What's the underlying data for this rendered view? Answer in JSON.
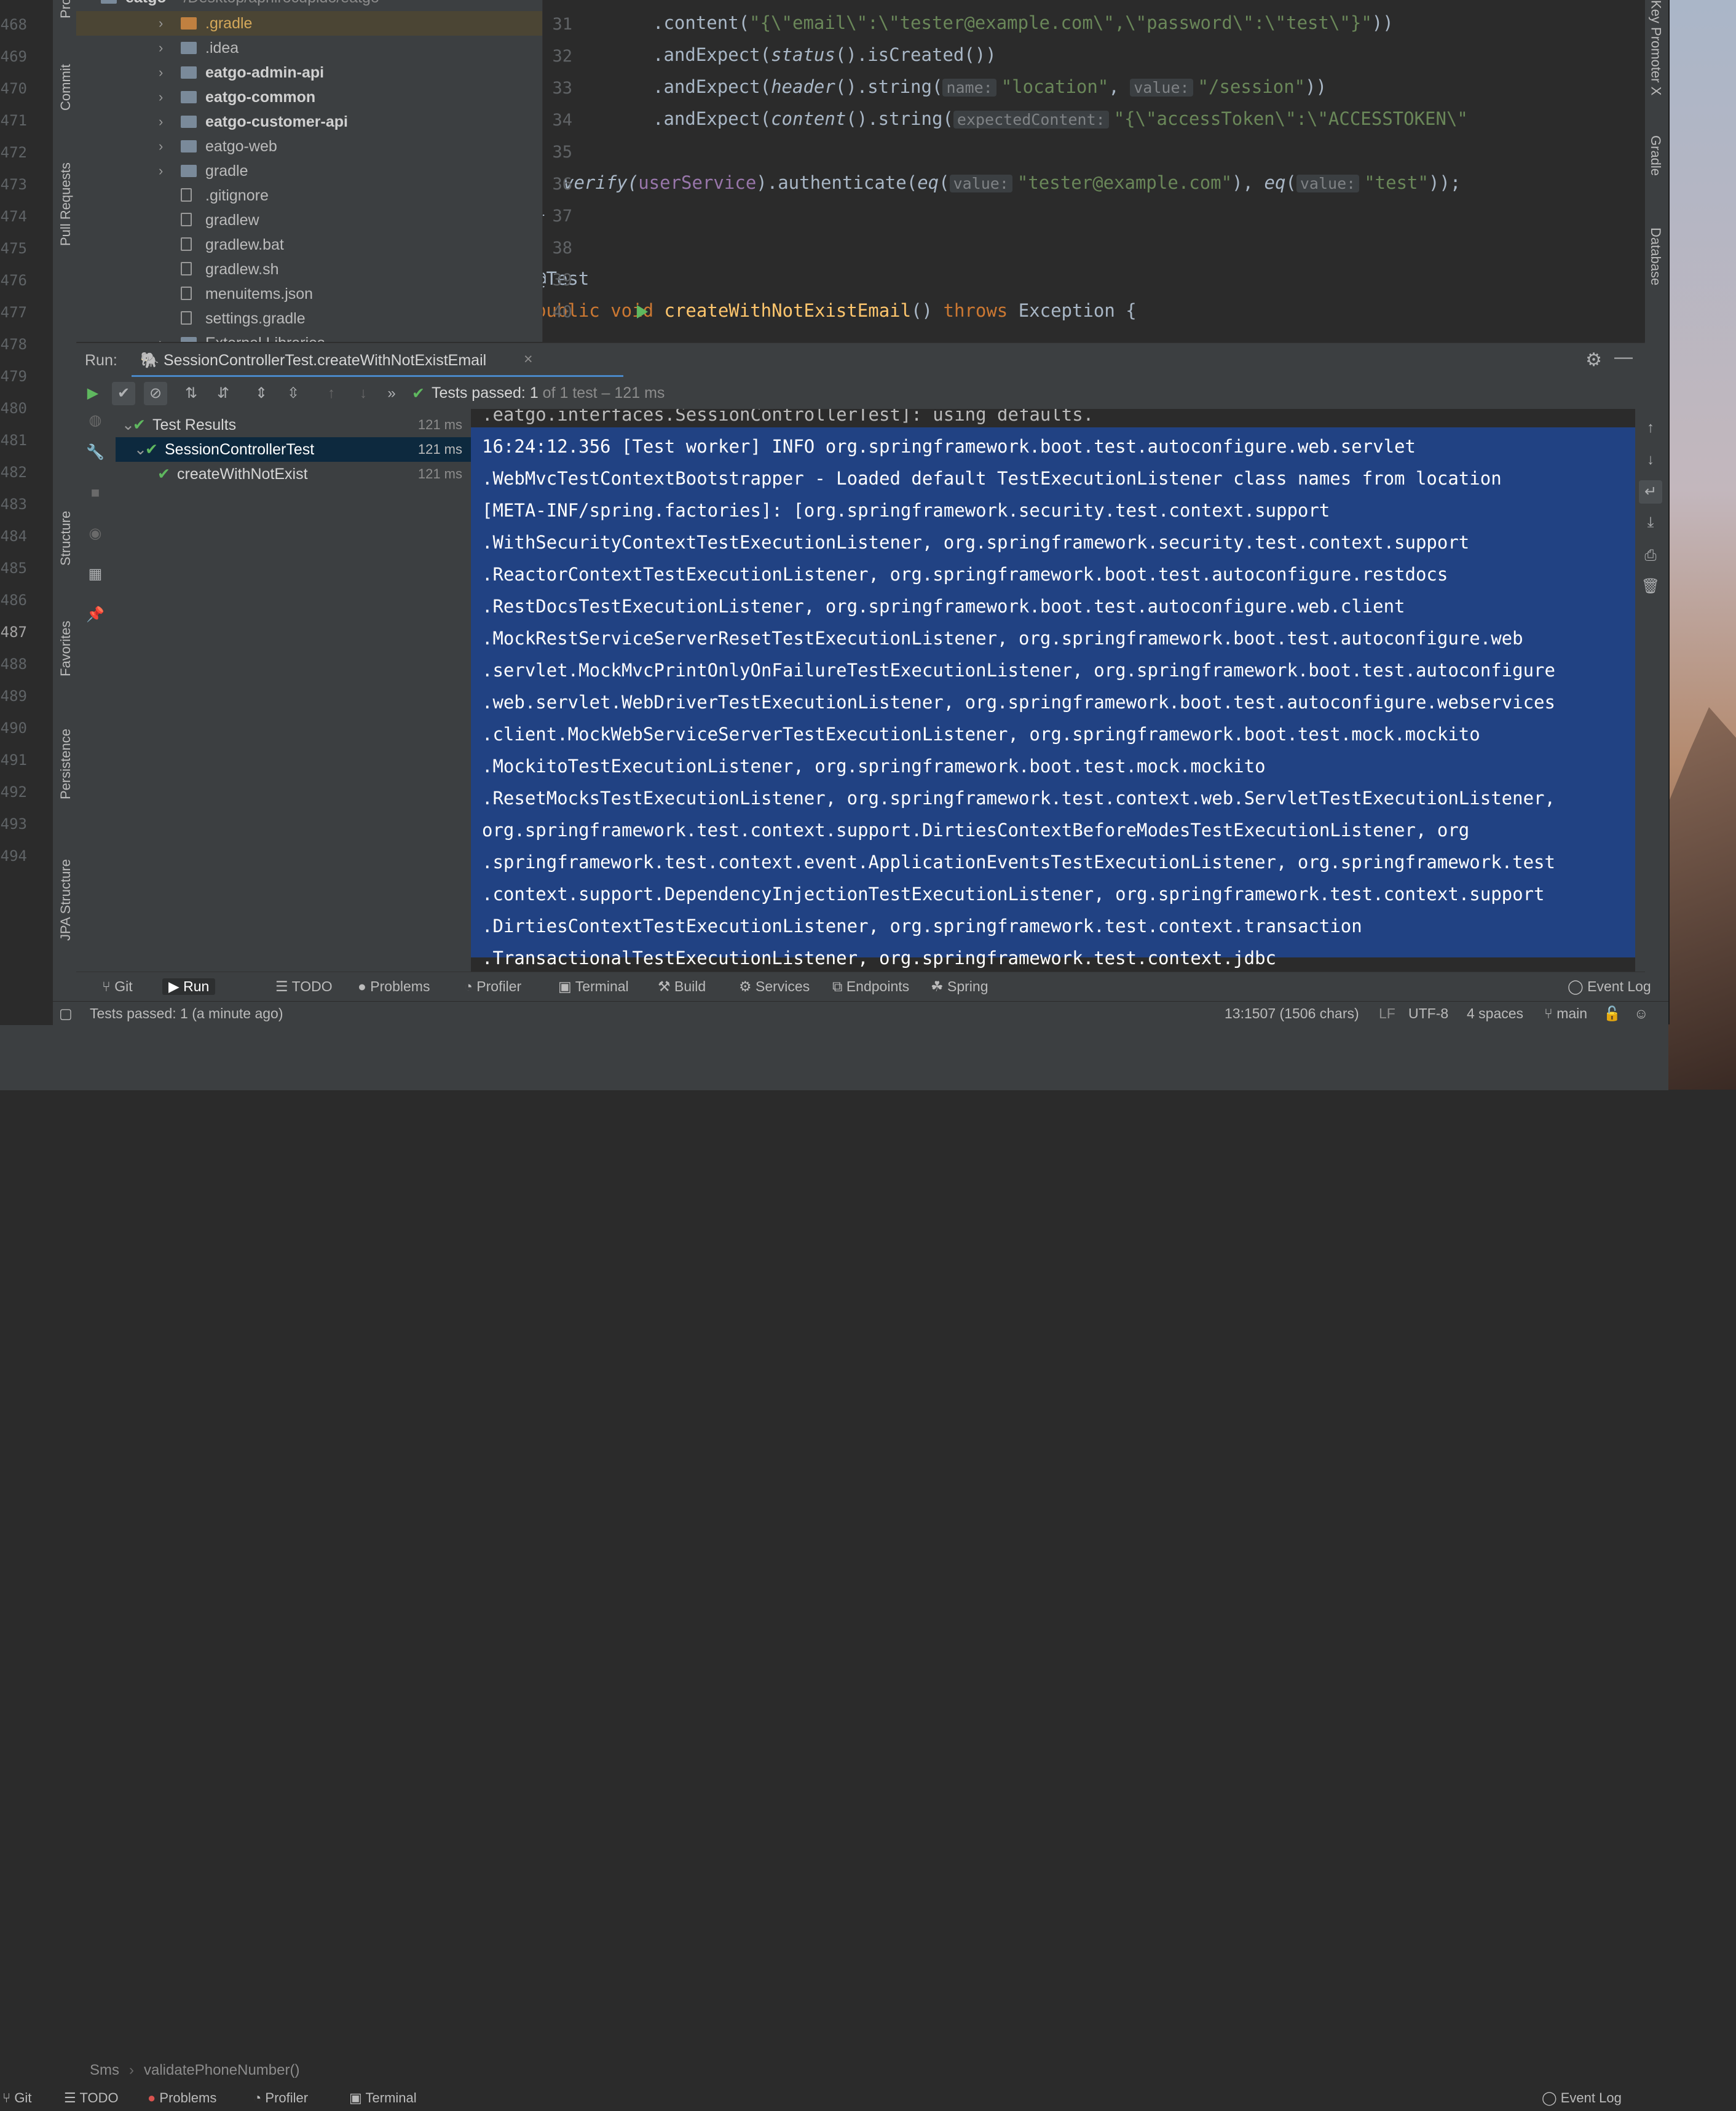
{
  "background": {
    "line_numbers": [
      "468",
      "469",
      "470",
      "471",
      "472",
      "473",
      "474",
      "475",
      "476",
      "477",
      "478",
      "479",
      "480",
      "481",
      "482",
      "483",
      "484",
      "485",
      "486",
      "487",
      "488",
      "489",
      "490",
      "491",
      "492",
      "493",
      "494"
    ],
    "breadcrumb": [
      "Sms",
      "validatePhoneNumber()"
    ],
    "toolbar": [
      "Git",
      "TODO",
      "Problems",
      "Profiler",
      "Terminal"
    ],
    "event_log": "Event Log"
  },
  "project": {
    "root_label": "eatgo",
    "root_path": "~/Desktop/aprilrocupido/eatgo",
    "items": [
      {
        "label": ".gradle",
        "type": "folder",
        "style": "selected-orange"
      },
      {
        "label": ".idea",
        "type": "folder"
      },
      {
        "label": "eatgo-admin-api",
        "type": "module"
      },
      {
        "label": "eatgo-common",
        "type": "module"
      },
      {
        "label": "eatgo-customer-api",
        "type": "module"
      },
      {
        "label": "eatgo-web",
        "type": "folder"
      },
      {
        "label": "gradle",
        "type": "folder"
      },
      {
        "label": ".gitignore",
        "type": "file"
      },
      {
        "label": "gradlew",
        "type": "file"
      },
      {
        "label": "gradlew.bat",
        "type": "file"
      },
      {
        "label": "gradlew.sh",
        "type": "file"
      },
      {
        "label": "menuitems.json",
        "type": "file"
      },
      {
        "label": "settings.gradle",
        "type": "file"
      },
      {
        "label": "External Libraries",
        "type": "library"
      }
    ]
  },
  "left_strip": [
    "Project",
    "Commit",
    "Pull Requests",
    "Structure",
    "Favorites",
    "Persistence",
    "JPA Structure"
  ],
  "right_strip": [
    "Key Promoter X",
    "Gradle",
    "Database"
  ],
  "editor": {
    "line_numbers": [
      "31",
      "32",
      "33",
      "34",
      "35",
      "36",
      "37",
      "38",
      "39",
      "40"
    ],
    "hints": {
      "name": "name:",
      "value": "value:",
      "expectedContent": "expectedContent:"
    },
    "code": {
      "l31_pre": ".content(",
      "l31_str": "\"{\\\"email\\\":\\\"tester@example.com\\\",\\\"password\\\":\\\"test\\\"}\"",
      "l31_post": "))",
      "l32": ".andExpect(status().isCreated())",
      "l33_pre": ".andExpect(header().string(",
      "l33_str1": "\"location\"",
      "l33_str2": "\"/session\"",
      "l33_post": "))",
      "l34_pre": ".andExpect(content().string(",
      "l34_str": "\"{\\\"accessToken\\\":\\\"ACCESSTOKEN\\\"",
      "l36_pre": "verify(",
      "l36_field": "userService",
      "l36_mid": ").authenticate(eq(",
      "l36_str1": "\"tester@example.com\"",
      "l36_mid2": "), eq(",
      "l36_str2": "\"test\"",
      "l36_post": "));",
      "l37": "}",
      "l39": "@Test",
      "l40_kw1": "public void ",
      "l40_method": "createWithNotExistEmail",
      "l40_post": "() ",
      "l40_kw2": "throws",
      "l40_exc": " Exception {"
    }
  },
  "run": {
    "label": "Run:",
    "tab_title": "SessionControllerTest.createWithNotExistEmail",
    "status_text": "Tests passed:",
    "status_count": "1",
    "status_detail": "of 1 test – 121 ms",
    "tree": [
      {
        "label": "Test Results",
        "time": "121 ms"
      },
      {
        "label": "SessionControllerTest",
        "time": "121 ms"
      },
      {
        "label": "createWithNotExist",
        "time": "121 ms"
      }
    ],
    "console": [
      ".eatgo.interfaces.SessionControllerTest]: using defaults.",
      "16:24:12.356 [Test worker] INFO org.springframework.boot.test.autoconfigure.web.servlet",
      ".WebMvcTestContextBootstrapper - Loaded default TestExecutionListener class names from location ",
      "[META-INF/spring.factories]: [org.springframework.security.test.context.support",
      ".WithSecurityContextTestExecutionListener, org.springframework.security.test.context.support",
      ".ReactorContextTestExecutionListener, org.springframework.boot.test.autoconfigure.restdocs",
      ".RestDocsTestExecutionListener, org.springframework.boot.test.autoconfigure.web.client",
      ".MockRestServiceServerResetTestExecutionListener, org.springframework.boot.test.autoconfigure.web",
      ".servlet.MockMvcPrintOnlyOnFailureTestExecutionListener, org.springframework.boot.test.autoconfigure",
      ".web.servlet.WebDriverTestExecutionListener, org.springframework.boot.test.autoconfigure.webservices",
      ".client.MockWebServiceServerTestExecutionListener, org.springframework.boot.test.mock.mockito",
      ".MockitoTestExecutionListener, org.springframework.boot.test.mock.mockito",
      ".ResetMocksTestExecutionListener, org.springframework.test.context.web.ServletTestExecutionListener, ",
      "org.springframework.test.context.support.DirtiesContextBeforeModesTestExecutionListener, org",
      ".springframework.test.context.event.ApplicationEventsTestExecutionListener, org.springframework.test",
      ".context.support.DependencyInjectionTestExecutionListener, org.springframework.test.context.support",
      ".DirtiesContextTestExecutionListener, org.springframework.test.context.transaction",
      ".TransactionalTestExecutionListener, org.springframework.test.context.jdbc"
    ]
  },
  "tool_windows": [
    "Git",
    "Run",
    "TODO",
    "Problems",
    "Profiler",
    "Terminal",
    "Build",
    "Services",
    "Endpoints",
    "Spring"
  ],
  "event_log": "Event Log",
  "status_bar": {
    "message": "Tests passed: 1 (a minute ago)",
    "position": "13:1507 (1506 chars)",
    "line_sep": "LF",
    "encoding": "UTF-8",
    "indent": "4 spaces",
    "branch": "main"
  },
  "colors": {
    "selection": "#214283",
    "pass_green": "#5fb85f",
    "keyword": "#cc7832",
    "string": "#6a8759",
    "method": "#ffc66d"
  }
}
